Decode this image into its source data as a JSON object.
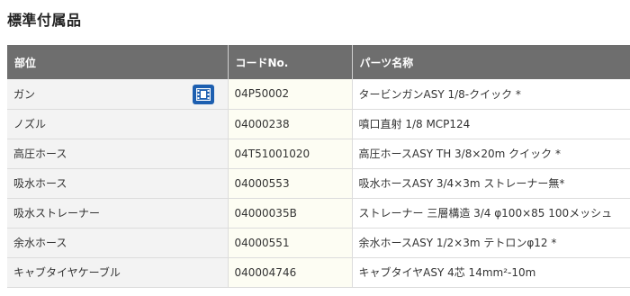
{
  "section": {
    "title": "標準付属品"
  },
  "table": {
    "headers": [
      "部位",
      "コードNo.",
      "パーツ名称"
    ],
    "rows": [
      {
        "part": "ガン",
        "code": "04P50002",
        "name": "タービンガンASY 1/8-クイック *",
        "has_video": true
      },
      {
        "part": "ノズル",
        "code": "04000238",
        "name": "噴口直射 1/8 MCP124"
      },
      {
        "part": "高圧ホース",
        "code": "04T51001020",
        "name": "高圧ホースASY TH 3/8×20m クイック *"
      },
      {
        "part": "吸水ホース",
        "code": "04000553",
        "name": "吸水ホースASY 3/4×3m ストレーナー無*"
      },
      {
        "part": "吸水ストレーナー",
        "code": "04000035B",
        "name": "ストレーナー 三層構造 3/4 φ100×85 100メッシュ"
      },
      {
        "part": "余水ホース",
        "code": "04000551",
        "name": "余水ホースASY 1/2×3m テトロンφ12 *"
      },
      {
        "part": "キャブタイヤケーブル",
        "code": "040004746",
        "name": "キャブタイヤASY 4芯 14mm²-10m"
      }
    ]
  },
  "icons": {
    "video": "film-video-icon"
  },
  "colors": {
    "header_bg": "#6e6e6e",
    "part_col_bg": "#f3f3f3",
    "code_col_bg": "#fdfdf3",
    "video_button": "#1d5fb0"
  }
}
